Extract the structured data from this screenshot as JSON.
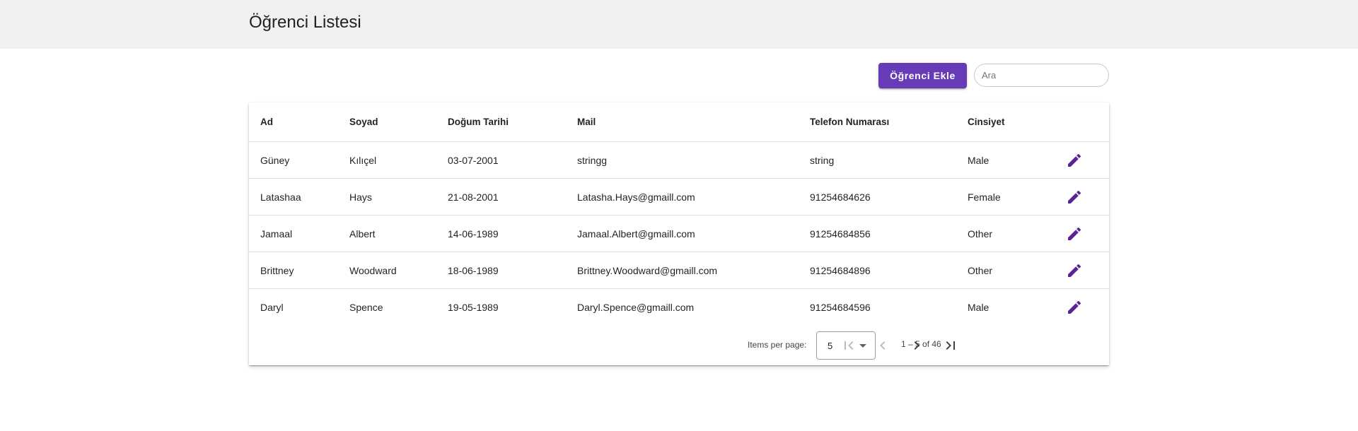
{
  "header": {
    "title": "Öğrenci Listesi"
  },
  "toolbar": {
    "add_label": "Öğrenci Ekle",
    "search_placeholder": "Ara",
    "search_value": ""
  },
  "table": {
    "columns": [
      "Ad",
      "Soyad",
      "Doğum Tarihi",
      "Mail",
      "Telefon Numarası",
      "Cinsiyet"
    ],
    "rows": [
      {
        "ad": "Güney",
        "soyad": "Kılıçel",
        "dogum": "03-07-2001",
        "mail": "stringg",
        "tel": "string",
        "cinsiyet": "Male"
      },
      {
        "ad": "Latashaa",
        "soyad": "Hays",
        "dogum": "21-08-2001",
        "mail": "Latasha.Hays@gmaill.com",
        "tel": "91254684626",
        "cinsiyet": "Female"
      },
      {
        "ad": "Jamaal",
        "soyad": "Albert",
        "dogum": "14-06-1989",
        "mail": "Jamaal.Albert@gmaill.com",
        "tel": "91254684856",
        "cinsiyet": "Other"
      },
      {
        "ad": "Brittney",
        "soyad": "Woodward",
        "dogum": "18-06-1989",
        "mail": "Brittney.Woodward@gmaill.com",
        "tel": "91254684896",
        "cinsiyet": "Other"
      },
      {
        "ad": "Daryl",
        "soyad": "Spence",
        "dogum": "19-05-1989",
        "mail": "Daryl.Spence@gmaill.com",
        "tel": "91254684596",
        "cinsiyet": "Male"
      }
    ],
    "row_action_icon": "edit-icon"
  },
  "paginator": {
    "items_per_page_label": "Items per page:",
    "page_size": "5",
    "range_label": "1 – 5 of 46",
    "icons": [
      "first-page-icon",
      "previous-page-icon",
      "next-page-icon",
      "last-page-icon"
    ]
  },
  "colors": {
    "accent": "#673ab7",
    "edit_icon": "#5b2495",
    "topbar": "#f0f0f0"
  }
}
